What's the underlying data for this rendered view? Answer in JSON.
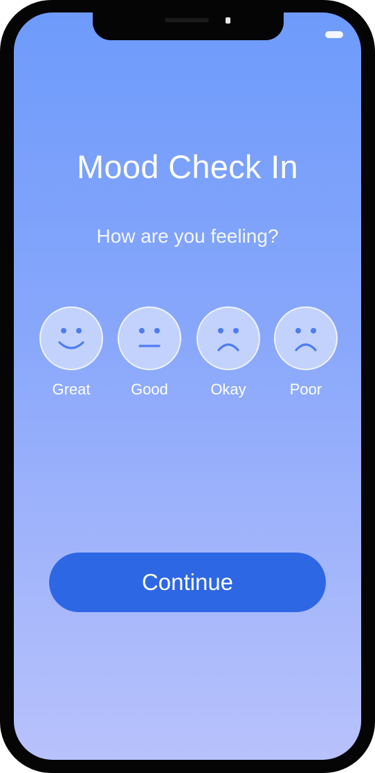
{
  "app": {
    "title": "Mood Check In",
    "prompt": "How are you feeling?"
  },
  "moods": [
    {
      "label": "Great",
      "icon": "smiling-face-icon"
    },
    {
      "label": "Good",
      "icon": "neutral-face-icon"
    },
    {
      "label": "Okay",
      "icon": "frowning-face-icon"
    },
    {
      "label": "Poor",
      "icon": "frowning-face-icon"
    }
  ],
  "actions": {
    "continue_label": "Continue"
  },
  "colors": {
    "background_top": "#6e9bfb",
    "background_bottom": "#b8c2fc",
    "face_fill": "#c3d2fd",
    "face_feature": "#4d7df0",
    "button": "#2e67e4",
    "text": "#ffffff"
  }
}
